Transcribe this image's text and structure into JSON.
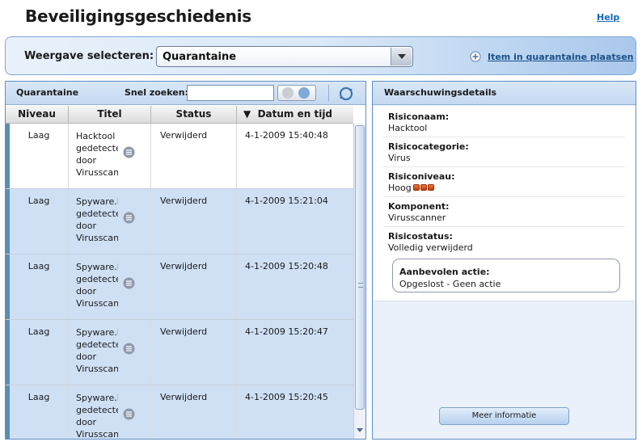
{
  "header": {
    "title": "Beveiligingsgeschiedenis",
    "help": "Help"
  },
  "viewbar": {
    "label": "Weergave selecteren:",
    "selected": "Quarantaine",
    "quarantine_link": "Item in quarantaine plaatsen"
  },
  "list": {
    "title": "Quarantaine",
    "search_label": "Snel zoeken:",
    "search_value": "",
    "columns": {
      "niveau": "Niveau",
      "titel": "Titel",
      "status": "Status",
      "datum": "Datum en tijd"
    },
    "rows": [
      {
        "niveau": "Laag",
        "titel": [
          "Hacktool",
          "gedetecteerd",
          "door",
          "Virusscanner"
        ],
        "status": "Verwijderd",
        "datum": "4-1-2009 15:40:48"
      },
      {
        "niveau": "Laag",
        "titel": [
          "Spyware.M",
          "gedetecteerd",
          "door",
          "Virusscanner"
        ],
        "status": "Verwijderd",
        "datum": "4-1-2009 15:21:04"
      },
      {
        "niveau": "Laag",
        "titel": [
          "Spyware.M",
          "gedetecteerd",
          "door",
          "Virusscanner"
        ],
        "status": "Verwijderd",
        "datum": "4-1-2009 15:20:48"
      },
      {
        "niveau": "Laag",
        "titel": [
          "Spyware.M",
          "gedetecteerd",
          "door",
          "Virusscanner"
        ],
        "status": "Verwijderd",
        "datum": "4-1-2009 15:20:47"
      },
      {
        "niveau": "Laag",
        "titel": [
          "Spyware.M",
          "gedetecteerd",
          "door",
          "Virusscanner"
        ],
        "status": "Verwijderd",
        "datum": "4-1-2009 15:20:45"
      }
    ]
  },
  "details": {
    "title": "Waarschuwingsdetails",
    "risiconaam_label": "Risiconaam:",
    "risiconaam": "Hacktool",
    "risicocategorie_label": "Risicocategorie:",
    "risicocategorie": "Virus",
    "risiconiveau_label": "Risiconiveau:",
    "risiconiveau": "Hoog",
    "risk_blocks": 3,
    "component_label": "Komponent:",
    "component": "Virusscanner",
    "risicostatus_label": "Risicostatus:",
    "risicostatus": "Volledig verwijderd",
    "actie_label": "Aanbevolen actie:",
    "actie": "Opgeslost - Geen actie",
    "more_button": "Meer informatie"
  },
  "colors": {
    "accent": "#1565b8",
    "row_selected": "#cfe0f5",
    "risk_high": "#d9531e"
  }
}
